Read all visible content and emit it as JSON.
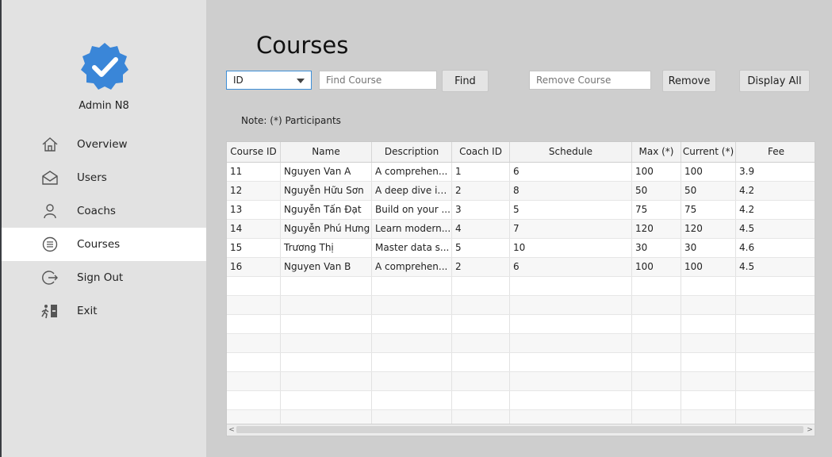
{
  "sidebar": {
    "user_name": "Admin N8",
    "badge_icon": "verified-badge-icon",
    "items": [
      {
        "label": "Overview",
        "icon": "home-icon",
        "active": false
      },
      {
        "label": "Users",
        "icon": "envelope-icon",
        "active": false
      },
      {
        "label": "Coachs",
        "icon": "person-icon",
        "active": false
      },
      {
        "label": "Courses",
        "icon": "list-circle-icon",
        "active": true
      },
      {
        "label": "Sign Out",
        "icon": "sign-out-icon",
        "active": false
      },
      {
        "label": "Exit",
        "icon": "exit-icon",
        "active": false
      }
    ]
  },
  "main": {
    "title": "Courses",
    "search": {
      "field_selected": "ID",
      "find_placeholder": "Find Course",
      "find_button": "Find",
      "remove_placeholder": "Remove Course",
      "remove_button": "Remove",
      "display_all_button": "Display All"
    },
    "note": "Note: (*) Participants",
    "table": {
      "columns": [
        "Course ID",
        "Name",
        "Description",
        "Coach ID",
        "Schedule",
        "Max (*)",
        "Current (*)",
        "Fee"
      ],
      "rows": [
        [
          "11",
          "Nguyen Van A",
          "A comprehen...",
          "1",
          "6",
          "100",
          "100",
          "3.9"
        ],
        [
          "12",
          "Nguyễn Hữu Sơn",
          "A deep dive in...",
          "2",
          "8",
          "50",
          "50",
          "4.2"
        ],
        [
          "13",
          "Nguyễn Tấn Đạt",
          "Build on your ...",
          "3",
          "5",
          "75",
          "75",
          "4.2"
        ],
        [
          "14",
          "Nguyễn Phú Hưng",
          "Learn modern...",
          "4",
          "7",
          "120",
          "120",
          "4.5"
        ],
        [
          "15",
          "Trương Thị",
          "Master data s...",
          "5",
          "10",
          "30",
          "30",
          "4.6"
        ],
        [
          "16",
          "Nguyen Van B",
          "A comprehen...",
          "2",
          "6",
          "100",
          "100",
          "4.5"
        ]
      ],
      "empty_rows": 8
    }
  },
  "colors": {
    "accent": "#3d8fd8",
    "badge": "#3a86d8",
    "sidebar_bg": "#e2e2e2",
    "main_bg": "#cecece"
  }
}
